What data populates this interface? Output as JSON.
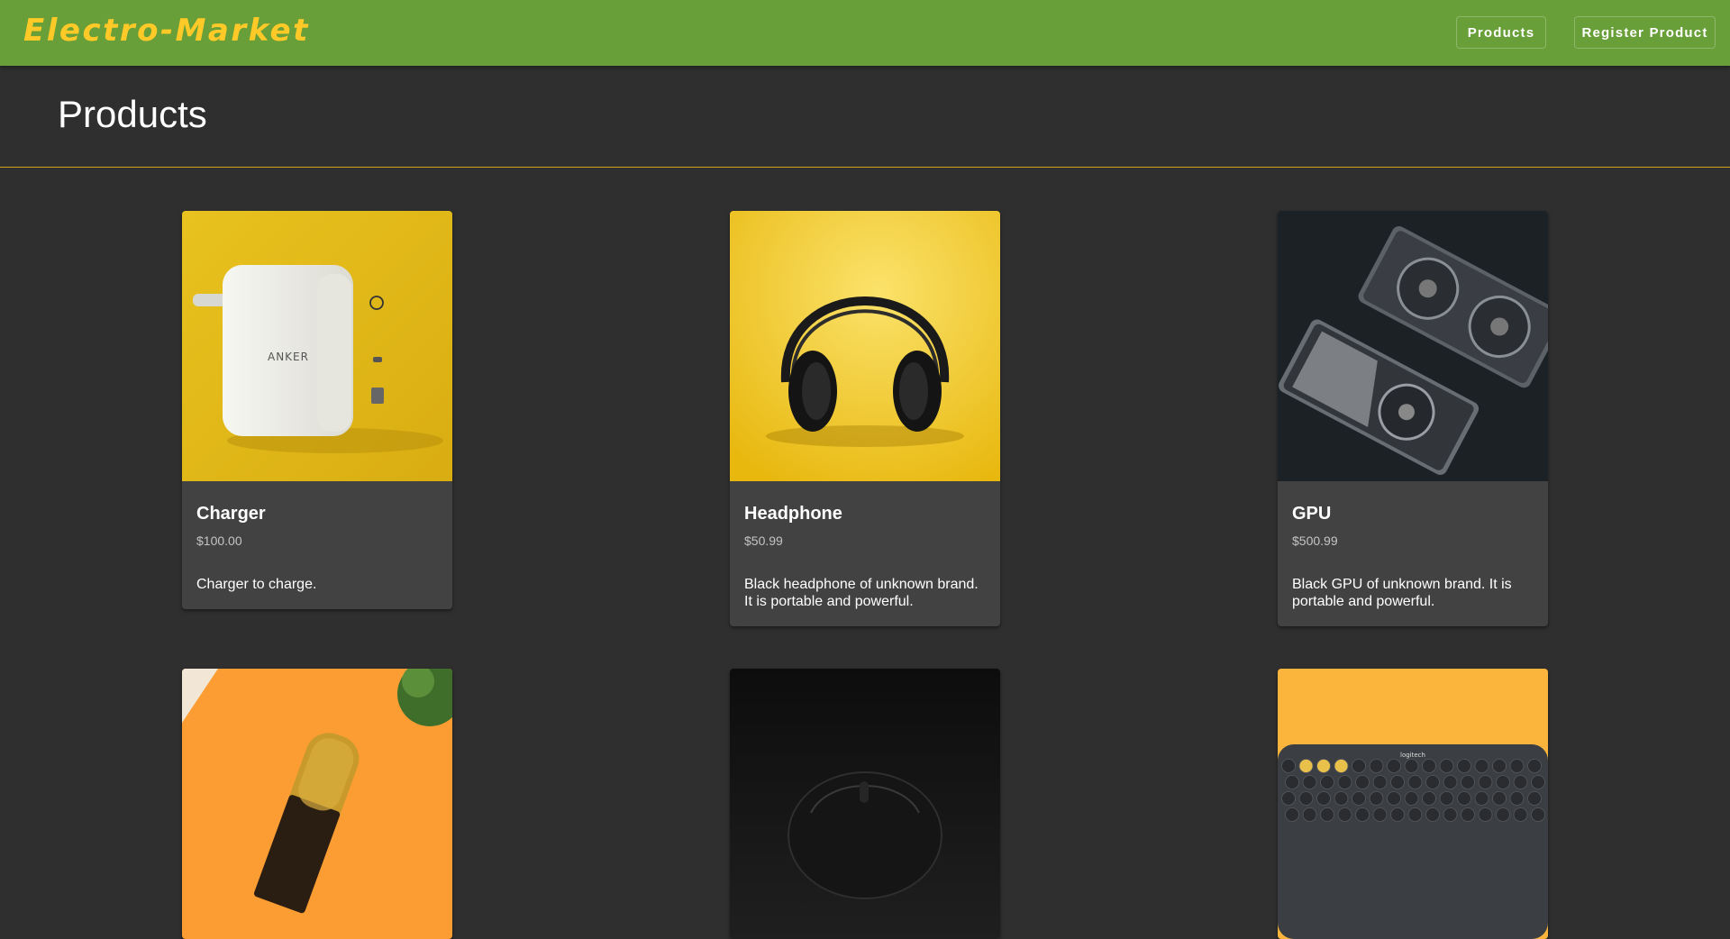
{
  "header": {
    "brand": "Electro-Market",
    "nav": {
      "products": "Products",
      "register": "Register Product"
    }
  },
  "page": {
    "title": "Products"
  },
  "products": [
    {
      "name": "Charger",
      "price": "$100.00",
      "description": "Charger to charge.",
      "image": "white-wall-charger-on-yellow"
    },
    {
      "name": "Headphone",
      "price": "$50.99",
      "description": "Black headphone of unknown brand. It is portable and powerful.",
      "image": "black-headphones-on-yellow"
    },
    {
      "name": "GPU",
      "price": "$500.99",
      "description": "Black GPU of unknown brand. It is portable and powerful.",
      "image": "graphics-cards-on-dark"
    },
    {
      "image": "gold-microphone-on-orange"
    },
    {
      "image": "black-mouse-on-dark"
    },
    {
      "image": "dark-keyboard-on-yellow"
    }
  ],
  "colors": {
    "topbar": "#689f38",
    "brand": "#ffca28",
    "background": "#2f2f2f",
    "card": "#424242",
    "divider": "#d4a017"
  }
}
